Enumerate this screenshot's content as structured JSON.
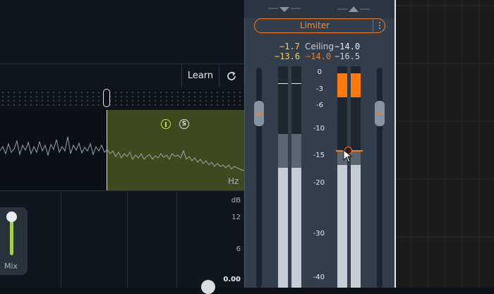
{
  "learn_button": {
    "label": "Learn"
  },
  "spectrum": {
    "unit_label": "Hz",
    "solo_label": "S"
  },
  "level_axis": {
    "unit": "dB",
    "ticks": [
      "12",
      "6",
      "0.00"
    ]
  },
  "mix": {
    "label": "Mix",
    "value": 1.0
  },
  "limiter": {
    "mode_label": "Limiter",
    "menu_glyph": "⋮",
    "ceiling_label": "Ceiling",
    "input_peak": "−1.7",
    "input_rms": "−13.6",
    "gain_reduction": "−14.0",
    "ceiling_value": "−14.0",
    "output_rms": "−16.5",
    "scale": [
      "0",
      "-3",
      "-6",
      "-10",
      "-15",
      "-20",
      "-30",
      "-40"
    ],
    "input_meter": {
      "peak_db": -1.5,
      "rms_db": -9.5,
      "low_db": -15.5
    },
    "output_meter": {
      "peak_db": -14.0,
      "rms_db": -15.5
    },
    "gr_meter_db": -3.5,
    "ceiling_db": -14.0,
    "input_fader_db": -6.0,
    "output_fader_db": -6.0
  },
  "colors": {
    "accent": "#ff7a1a",
    "value_yellow": "#ffd23f",
    "selection": "#3e4a1e",
    "mix_track": "#a4d14b"
  }
}
